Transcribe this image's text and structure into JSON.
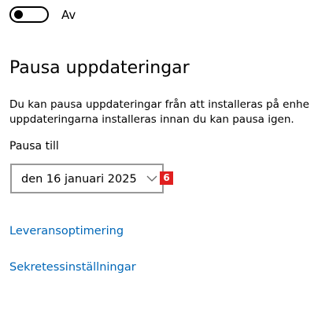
{
  "toggle": {
    "state_label": "Av"
  },
  "pause": {
    "title": "Pausa uppdateringar",
    "description_lines": [
      "Du kan pausa uppdateringar från att installeras på enhe",
      "uppdateringarna installeras innan du kan pausa igen."
    ],
    "until_label": "Pausa till",
    "selected_date": "den 16 januari 2025",
    "marker": "6"
  },
  "links": {
    "delivery_optimization": "Leveransoptimering",
    "privacy_settings": "Sekretessinställningar"
  },
  "colors": {
    "link": "#0067b8",
    "dropdown_border": "#999999",
    "marker_bg": "#e02020"
  },
  "icons": {
    "dropdown": "chevron-down-icon"
  }
}
